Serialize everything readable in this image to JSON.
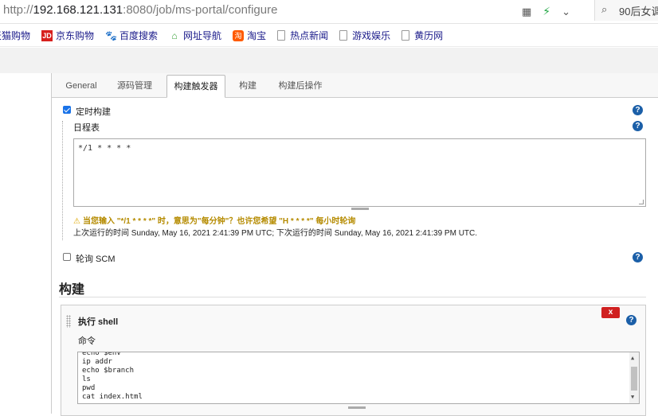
{
  "browser": {
    "url_prefix": "http://",
    "url_host": "192.168.121.131",
    "url_path": ":8080/job/ms-portal/configure",
    "search_text": "90后女调"
  },
  "bookmarks": [
    {
      "label": "天猫购物",
      "icon": "tmall-icon"
    },
    {
      "label": "京东购物",
      "icon": "jd-icon"
    },
    {
      "label": "百度搜索",
      "icon": "baidu-paw-icon"
    },
    {
      "label": "网址导航",
      "icon": "home-nav-icon"
    },
    {
      "label": "淘宝",
      "icon": "taobao-icon"
    },
    {
      "label": "热点新闻",
      "icon": "page-icon"
    },
    {
      "label": "游戏娱乐",
      "icon": "page-icon"
    },
    {
      "label": "黄历网",
      "icon": "page-icon"
    }
  ],
  "tabs": [
    "General",
    "源码管理",
    "构建触发器",
    "构建",
    "构建后操作"
  ],
  "active_tab": "构建触发器",
  "triggers": {
    "timer_label": "定时构建",
    "timer_checked": true,
    "schedule_label": "日程表",
    "schedule_value": "*/1 * * * *",
    "warning": "当您输入 \"*/1 * * * *\" 时，意思为\"每分钟\"？也许您希望 \"H * * * *\" 每小时轮询",
    "run_info": "上次运行的时间 Sunday, May 16, 2021 2:41:39 PM UTC; 下次运行的时间 Sunday, May 16, 2021 2:41:39 PM UTC.",
    "scm_label": "轮询 SCM",
    "scm_checked": false
  },
  "build": {
    "section_title": "构建",
    "step_title": "执行 shell",
    "delete_label": "x",
    "command_label": "命令",
    "command_lines": [
      "echo $env",
      "ip addr",
      "echo $branch",
      "ls",
      "pwd",
      "cat index.html"
    ]
  },
  "help_symbol": "?",
  "colors": {
    "help_blue": "#1b5fa8",
    "warning_text": "#b58b00",
    "delete_red": "#d02020",
    "checkbox_blue": "#1a73e8"
  }
}
